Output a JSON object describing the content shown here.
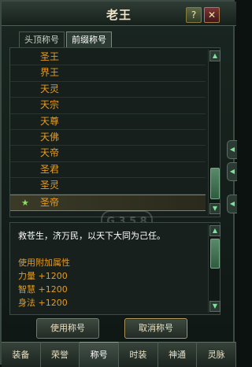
{
  "window": {
    "title": "老王",
    "help_label": "?",
    "close_label": "✕"
  },
  "tabs": [
    {
      "label": "头顶称号",
      "active": false
    },
    {
      "label": "前缀称号",
      "active": true
    }
  ],
  "titles_list": [
    {
      "label": "圣王"
    },
    {
      "label": "界王"
    },
    {
      "label": "天灵"
    },
    {
      "label": "天宗"
    },
    {
      "label": "天尊"
    },
    {
      "label": "天佛"
    },
    {
      "label": "天帝"
    },
    {
      "label": "圣君"
    },
    {
      "label": "圣灵"
    },
    {
      "label": "圣帝",
      "selected": true
    }
  ],
  "list_scrollbar": {
    "up_icon": "up-arrow-icon",
    "down_icon": "down-arrow-icon"
  },
  "watermark": {
    "text": "G 3 5 8"
  },
  "description": {
    "text": "救苍生，济万民，以天下大同为己任。",
    "attr_title": "使用附加属性",
    "attrs": [
      "力量  +1200",
      "智慧  +1200",
      "身法  +1200"
    ]
  },
  "actions": {
    "use_label": "使用称号",
    "cancel_label": "取消称号"
  },
  "bottom_tabs": [
    {
      "label": "装备"
    },
    {
      "label": "荣誉"
    },
    {
      "label": "称号",
      "active": true
    },
    {
      "label": "时装"
    },
    {
      "label": "神通"
    },
    {
      "label": "灵脉"
    }
  ],
  "side_nubs": [
    "◀",
    "◀",
    "◀"
  ],
  "colors": {
    "accent": "#e99b1a",
    "panel": "#17201c",
    "selected_star": "#8fdc6b"
  }
}
